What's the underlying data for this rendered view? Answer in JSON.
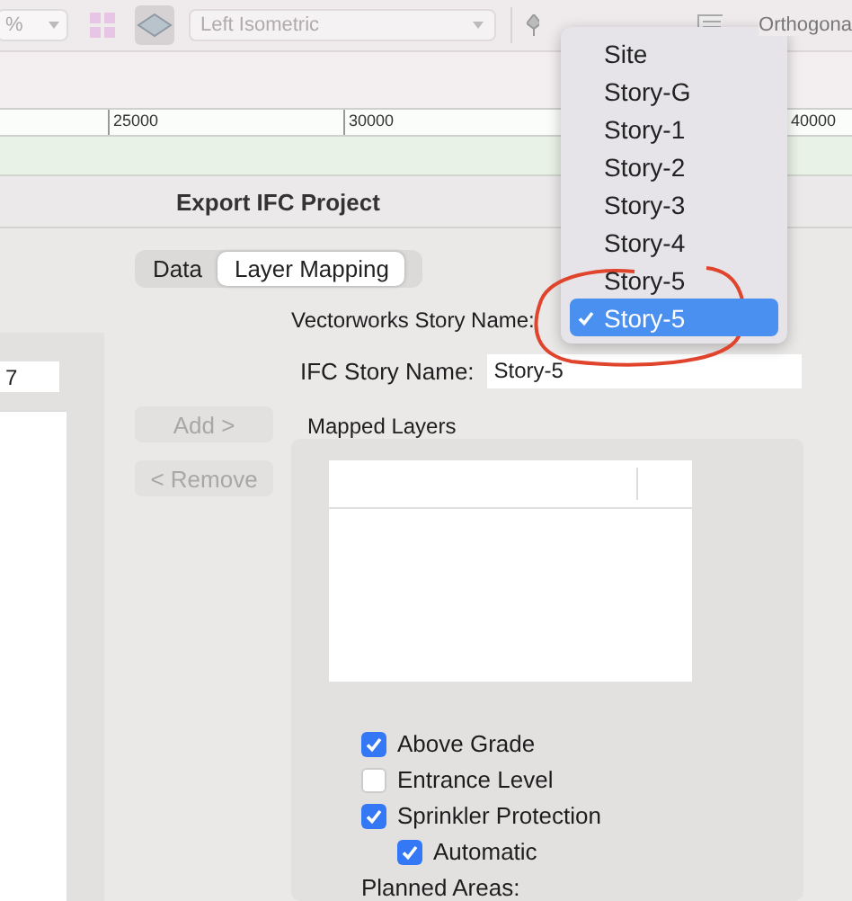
{
  "toolbar": {
    "zoom_field": "%",
    "view_popup": "Left Isometric",
    "projection_label": "Orthogona"
  },
  "ruler": {
    "labels": [
      "25000",
      "30000",
      "40000"
    ]
  },
  "dialog": {
    "title": "Export IFC Project",
    "left_field": "7",
    "tabs": [
      {
        "label": "Data",
        "selected": false
      },
      {
        "label": "Layer Mapping",
        "selected": true
      }
    ],
    "story_label": "Vectorworks Story Name:",
    "ifc_label": "IFC Story Name:",
    "ifc_value": "Story-5",
    "buttons": [
      {
        "label": "Add >",
        "disabled": true
      },
      {
        "label": "< Remove",
        "disabled": true
      }
    ],
    "mapped_layers_title": "Mapped Layers",
    "options": [
      {
        "label": "Above Grade",
        "checked": true
      },
      {
        "label": "Entrance Level",
        "checked": false
      },
      {
        "label": "Sprinkler Protection",
        "checked": true,
        "children": [
          {
            "label": "Automatic",
            "checked": true
          }
        ]
      }
    ],
    "planned_areas_label": "Planned Areas:"
  },
  "story_menu": {
    "items": [
      {
        "label": "Site",
        "selected": false
      },
      {
        "label": "Story-G",
        "selected": false
      },
      {
        "label": "Story-1",
        "selected": false
      },
      {
        "label": "Story-2",
        "selected": false
      },
      {
        "label": "Story-3",
        "selected": false
      },
      {
        "label": "Story-4",
        "selected": false
      },
      {
        "label": "Story-5",
        "selected": false
      },
      {
        "label": "Story-5",
        "selected": true
      }
    ]
  }
}
